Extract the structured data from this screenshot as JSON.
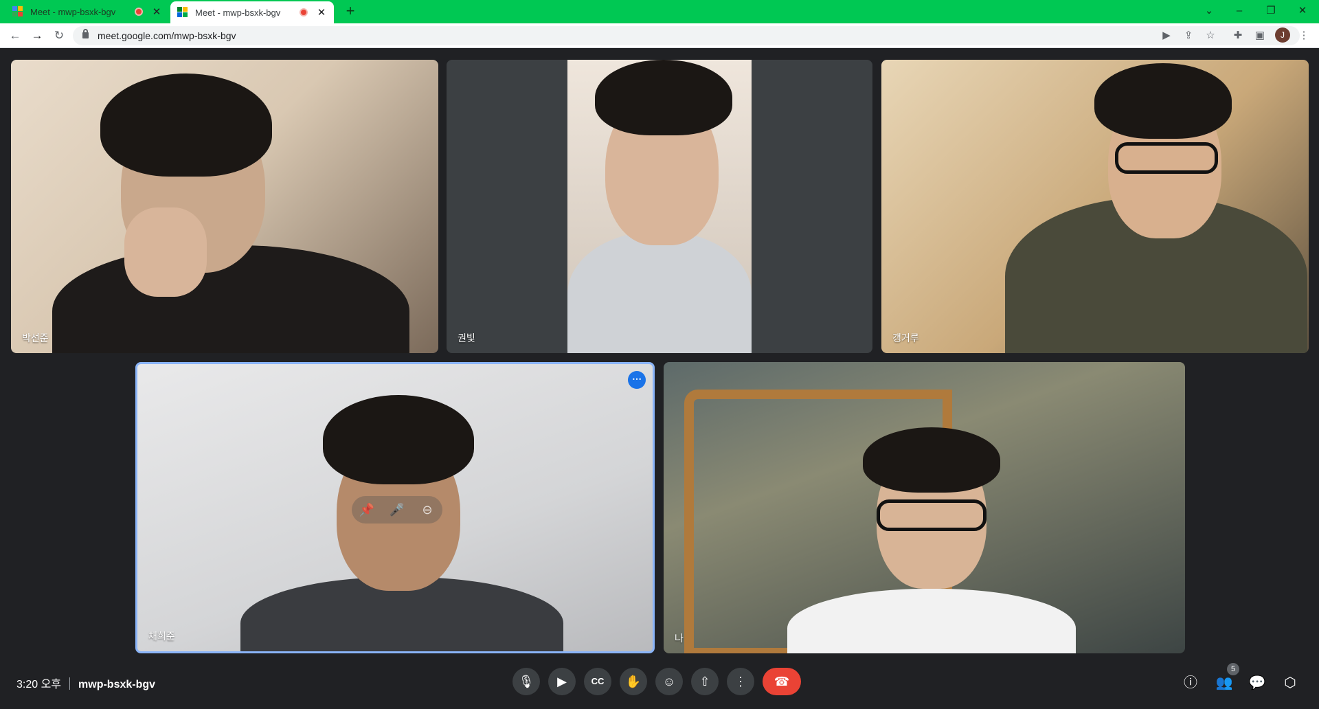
{
  "browser": {
    "tabs": [
      {
        "title": "Meet - mwp-bsxk-bgv",
        "active": false
      },
      {
        "title": "Meet - mwp-bsxk-bgv",
        "active": true
      }
    ],
    "new_tab_icon": "plus-icon",
    "close_glyph": "✕",
    "url": "meet.google.com/mwp-bsxk-bgv",
    "profile_initial": "J",
    "accent_color": "#00c853"
  },
  "participants": [
    {
      "name": "박선준"
    },
    {
      "name": "권빛"
    },
    {
      "name": "갱거루"
    },
    {
      "name": "채희준",
      "active_speaker": true
    },
    {
      "name": "나"
    }
  ],
  "meeting": {
    "time": "3:20 오후",
    "code": "mwp-bsxk-bgv",
    "people_count": "5"
  },
  "controls": {
    "mic": "mic-icon",
    "camera": "camera-icon",
    "captions": "captions-icon",
    "raise_hand": "raise-hand-icon",
    "reactions": "emoji-icon",
    "present": "present-screen-icon",
    "more": "more-options-icon",
    "end_call": "end-call-icon",
    "end_call_color": "#ea4335"
  }
}
